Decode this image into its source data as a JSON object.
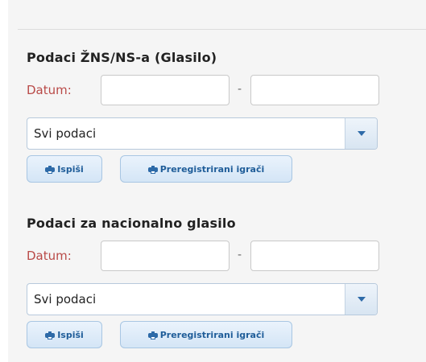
{
  "sections": [
    {
      "title": "Podaci ŽNS/NS-a (Glasilo)",
      "date_label": "Datum:",
      "date_from": "",
      "date_to": "",
      "date_separator": "-",
      "select_value": "Svi podaci",
      "print_label": "Ispiši",
      "prereg_label": "Preregistrirani igrači"
    },
    {
      "title": "Podaci za nacionalno glasilo",
      "date_label": "Datum:",
      "date_from": "",
      "date_to": "",
      "date_separator": "-",
      "select_value": "Svi podaci",
      "print_label": "Ispiši",
      "prereg_label": "Preregistrirani igrači"
    }
  ],
  "icons": {
    "print": "printer-icon",
    "select_arrow": "chevron-down-icon"
  },
  "colors": {
    "label_red": "#b94a48",
    "button_text": "#1f5d99",
    "button_bg": "#d4e5f6"
  }
}
